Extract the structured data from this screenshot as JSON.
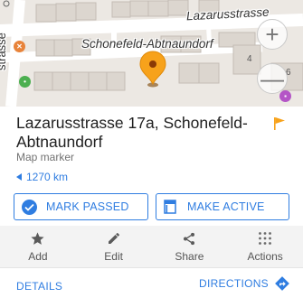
{
  "map": {
    "street_top": "Lazarusstrasse",
    "street_middle": "Schonefeld-Abtnaundorf",
    "street_left": "strasse",
    "house_number": "4",
    "house_number_2": "6",
    "zoom_in": "+",
    "zoom_out": "—"
  },
  "place": {
    "title": "Lazarusstrasse 17a, Schonefeld-Abtnaundorf",
    "subtitle": "Map marker",
    "distance": "1270 km",
    "flag_color": "#f7a21b",
    "marker_color": "#f7a21b"
  },
  "buttons": {
    "mark_passed": "MARK PASSED",
    "make_active": "MAKE ACTIVE"
  },
  "actions": [
    {
      "label": "Add",
      "icon": "star-icon"
    },
    {
      "label": "Edit",
      "icon": "pencil-icon"
    },
    {
      "label": "Share",
      "icon": "share-icon"
    },
    {
      "label": "Actions",
      "icon": "grid-dots-icon"
    }
  ],
  "bottom": {
    "details": "DETAILS",
    "directions": "DIRECTIONS"
  },
  "colors": {
    "accent": "#2f7de1",
    "marker": "#f7a21b"
  }
}
